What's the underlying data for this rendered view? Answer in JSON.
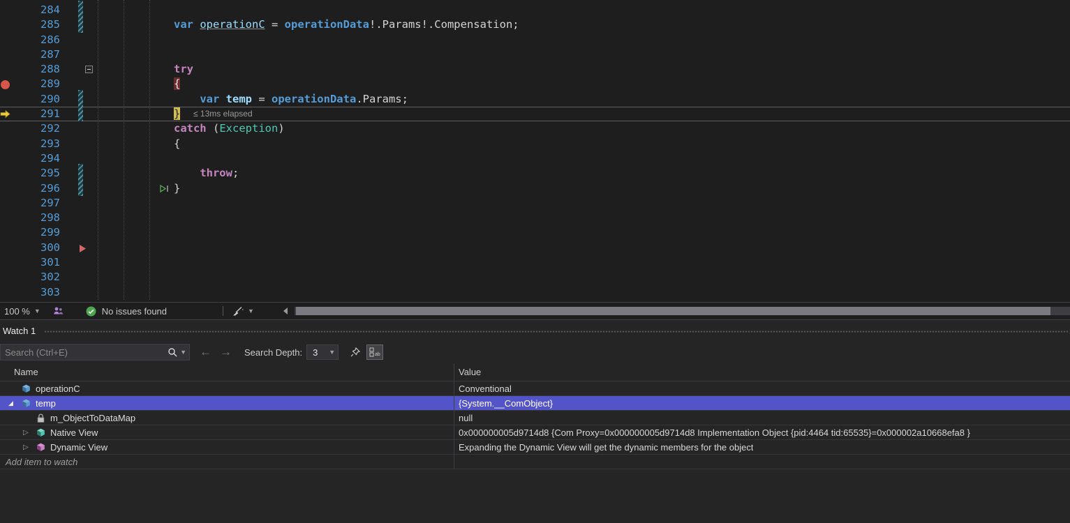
{
  "editor": {
    "first_line": 284,
    "line_height": 21.3,
    "top_pad": 4,
    "lines": [
      {
        "num": 284,
        "tokens": []
      },
      {
        "num": 285,
        "tokens": [
          {
            "t": "            ",
            "c": "plain"
          },
          {
            "t": "var",
            "c": "kw"
          },
          {
            "t": " ",
            "c": "plain"
          },
          {
            "t": "operationC",
            "c": "local u"
          },
          {
            "t": " = ",
            "c": "plain"
          },
          {
            "t": "operationData",
            "c": "decl"
          },
          {
            "t": "!.Params!.Compensation;",
            "c": "plain"
          }
        ]
      },
      {
        "num": 286,
        "tokens": []
      },
      {
        "num": 287,
        "tokens": []
      },
      {
        "num": 288,
        "tokens": [
          {
            "t": "            ",
            "c": "plain"
          },
          {
            "t": "try",
            "c": "ctrl"
          }
        ]
      },
      {
        "num": 289,
        "tokens": [
          {
            "t": "            ",
            "c": "plain"
          },
          {
            "t": "{",
            "c": "bp"
          }
        ]
      },
      {
        "num": 290,
        "tokens": [
          {
            "t": "                ",
            "c": "plain"
          },
          {
            "t": "var",
            "c": "kw"
          },
          {
            "t": " ",
            "c": "plain"
          },
          {
            "t": "temp",
            "c": "local b"
          },
          {
            "t": " = ",
            "c": "plain"
          },
          {
            "t": "operationData",
            "c": "decl"
          },
          {
            "t": ".Params;",
            "c": "plain"
          }
        ]
      },
      {
        "num": 291,
        "current": true,
        "tokens": [
          {
            "t": "            ",
            "c": "plain"
          },
          {
            "t": "}",
            "c": "cur"
          },
          {
            "t": "  ",
            "c": "plain"
          },
          {
            "t": "≤ 13ms elapsed",
            "c": "perf"
          }
        ]
      },
      {
        "num": 292,
        "tokens": [
          {
            "t": "            ",
            "c": "plain"
          },
          {
            "t": "catch",
            "c": "ctrl"
          },
          {
            "t": " (",
            "c": "plain"
          },
          {
            "t": "Exception",
            "c": "type"
          },
          {
            "t": ")",
            "c": "plain"
          }
        ]
      },
      {
        "num": 293,
        "tokens": [
          {
            "t": "            ",
            "c": "plain"
          },
          {
            "t": "{",
            "c": "plain"
          }
        ]
      },
      {
        "num": 294,
        "tokens": []
      },
      {
        "num": 295,
        "tokens": [
          {
            "t": "                ",
            "c": "plain"
          },
          {
            "t": "throw",
            "c": "ctrl"
          },
          {
            "t": ";",
            "c": "plain"
          }
        ]
      },
      {
        "num": 296,
        "tokens": [
          {
            "t": "            ",
            "c": "plain"
          },
          {
            "t": "}",
            "c": "plain"
          }
        ]
      },
      {
        "num": 297,
        "tokens": []
      },
      {
        "num": 298,
        "tokens": []
      },
      {
        "num": 299,
        "tokens": []
      },
      {
        "num": 300,
        "tokens": []
      },
      {
        "num": 301,
        "tokens": []
      },
      {
        "num": 302,
        "tokens": []
      },
      {
        "num": 303,
        "tokens": []
      }
    ],
    "markers": [
      {
        "type": "breakpoint-icon",
        "line": 289
      },
      {
        "type": "current-statement-arrow-icon",
        "line": 291
      },
      {
        "type": "fold-collapse-box",
        "line": 288
      },
      {
        "type": "run-to-cursor-icon",
        "line": 296
      },
      {
        "type": "tracepoint-arrow-icon",
        "line": 300
      }
    ],
    "change_bars": [
      {
        "from": 284,
        "to": 285
      },
      {
        "from": 290,
        "to": 291
      },
      {
        "from": 295,
        "to": 296
      }
    ]
  },
  "status": {
    "zoom": "100 %",
    "no_issues": "No issues found"
  },
  "watch": {
    "title": "Watch 1",
    "search_placeholder": "Search (Ctrl+E)",
    "depth_label": "Search Depth:",
    "depth_value": "3",
    "columns": {
      "name": "Name",
      "value": "Value"
    },
    "rows": [
      {
        "indent": 0,
        "expander": null,
        "icon": "field-icon",
        "name": "operationC",
        "value": "Conventional"
      },
      {
        "indent": 0,
        "expander": "expanded",
        "icon": "field-icon",
        "name": "temp",
        "value": "{System.__ComObject}",
        "selected": true
      },
      {
        "indent": 1,
        "expander": null,
        "icon": "lock-icon",
        "name": "m_ObjectToDataMap",
        "value": "null"
      },
      {
        "indent": 1,
        "expander": "collapsed",
        "icon": "native-view-icon",
        "name": "Native View",
        "value": "0x000000005d9714d8 {Com Proxy=0x000000005d9714d8 Implementation Object {pid:4464 tid:65535}=0x000002a10668efa8 }"
      },
      {
        "indent": 1,
        "expander": "collapsed",
        "icon": "dynamic-view-icon",
        "name": "Dynamic View",
        "value": "Expanding the Dynamic View will get the dynamic members for the object"
      },
      {
        "add_row": true,
        "name": "Add item to watch",
        "value": ""
      }
    ]
  },
  "colors": {
    "editor_bg": "#1E1E1E",
    "panel_bg": "#252526",
    "selection": "#5254C8",
    "breakpoint_red": "#D6564A",
    "breakpoint_line_bg": "#6B2C31",
    "current_statement_yellow": "#D0BE4F",
    "keyword_blue": "#569CD6",
    "control_keyword_purple": "#C586C0",
    "type_teal": "#4EC9B0",
    "line_number_blue": "#569CD6",
    "changed_bar_teal": "#4E8F9E"
  }
}
